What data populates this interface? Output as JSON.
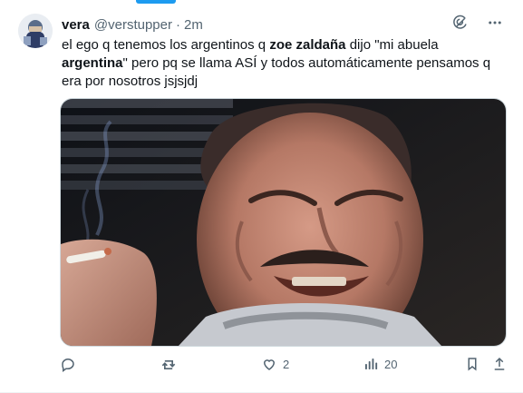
{
  "tweet": {
    "display_name": "vera",
    "handle": "@verstupper",
    "separator": "·",
    "time": "2m",
    "text": {
      "p1": "el ego q tenemos los argentinos q ",
      "b1": "zoe zaldaña",
      "p2": " dijo \"mi abuela ",
      "b2": "argentina",
      "p3": "\" pero pq se llama ASÍ y todos automáticamente pensamos q era por nosotros jsjsjdj"
    },
    "media_description": "",
    "stats": {
      "replies": "",
      "retweets": "",
      "likes": "2",
      "views": "20"
    }
  },
  "icons": {
    "top": [
      "grok-icon",
      "more-icon"
    ],
    "actions": [
      "reply-icon",
      "retweet-icon",
      "like-icon",
      "views-icon",
      "bookmark-icon",
      "share-icon"
    ]
  },
  "colors": {
    "accent": "#1d9bf0",
    "text": "#0f1419",
    "secondary": "#536471",
    "border": "#cfd9de"
  }
}
